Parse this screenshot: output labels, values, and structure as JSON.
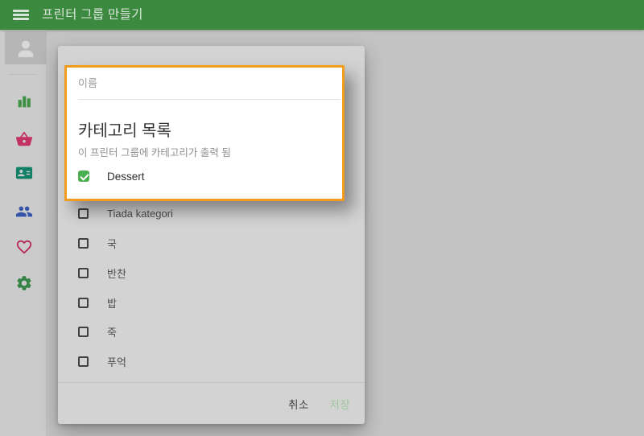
{
  "header": {
    "title": "프린터 그룹 만들기"
  },
  "sidebar": {
    "items": [
      {
        "id": "stats",
        "icon": "bar-chart-icon",
        "color": "#3f9043"
      },
      {
        "id": "orders",
        "icon": "basket-icon",
        "color": "#c23264"
      },
      {
        "id": "contacts",
        "icon": "contact-card-icon",
        "color": "#118066"
      },
      {
        "id": "customers",
        "icon": "people-icon",
        "color": "#3354a8"
      },
      {
        "id": "favorites",
        "icon": "heart-icon",
        "color": "#b52a5b"
      },
      {
        "id": "settings",
        "icon": "gear-icon",
        "color": "#368347"
      }
    ]
  },
  "dialog": {
    "name_placeholder": "이름",
    "section_title": "카테고리 목록",
    "section_subtitle": "이 프린터 그룹에 카테고리가 출력 됨",
    "highlighted_category": {
      "label": "Dessert",
      "checked": true
    },
    "categories": [
      {
        "label": "Tiada kategori",
        "checked": false
      },
      {
        "label": "국",
        "checked": false
      },
      {
        "label": "반찬",
        "checked": false
      },
      {
        "label": "밥",
        "checked": false
      },
      {
        "label": "죽",
        "checked": false
      },
      {
        "label": "푸억",
        "checked": false
      }
    ],
    "cancel_label": "취소",
    "save_label": "저장"
  },
  "colors": {
    "header_green": "#3b8a3f",
    "highlight_orange": "#f19c1d",
    "checkbox_green": "#4caf50",
    "save_green": "#9cc79c",
    "overlay_gray": "#c3c3c3",
    "dialog_gray": "#d3d3d3"
  }
}
